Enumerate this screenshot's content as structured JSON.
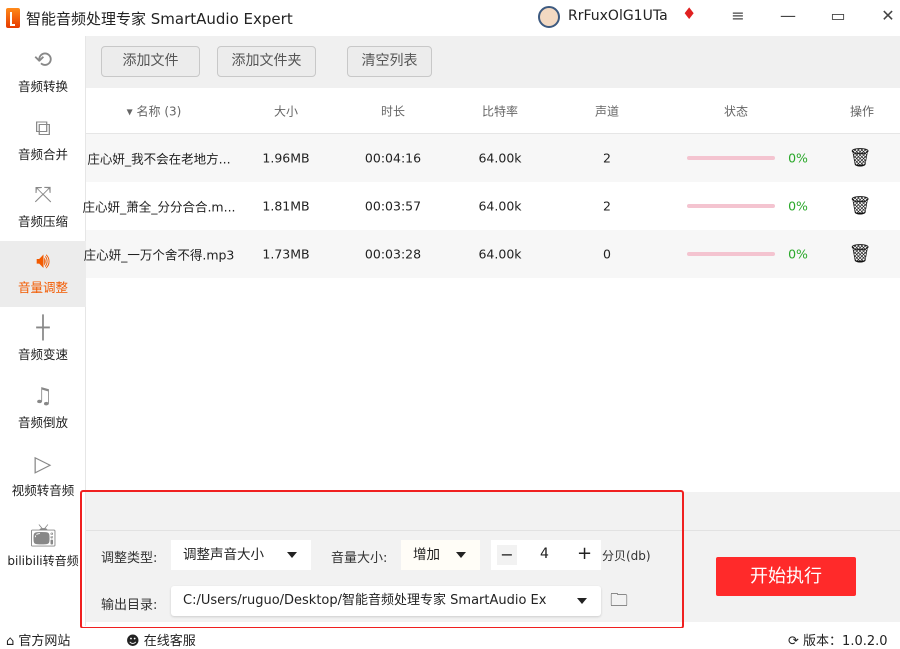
{
  "window": {
    "title": "智能音频处理专家 SmartAudio Expert",
    "username": "RrFuxOlG1UTa"
  },
  "sidebar": {
    "items": [
      {
        "label": "音频转换",
        "icon": "convert-icon"
      },
      {
        "label": "音频合并",
        "icon": "merge-icon"
      },
      {
        "label": "音频压缩",
        "icon": "compress-icon"
      },
      {
        "label": "音量调整",
        "icon": "volume-icon",
        "active": true
      },
      {
        "label": "音频变速",
        "icon": "speed-icon"
      },
      {
        "label": "音频倒放",
        "icon": "music-note-icon"
      },
      {
        "label": "视频转音频",
        "icon": "play-icon"
      },
      {
        "label": "bilibili转音频",
        "icon": "bilibili-icon"
      }
    ]
  },
  "toolbar": {
    "add_file": "添加文件",
    "add_folder": "添加文件夹",
    "clear_list": "清空列表"
  },
  "table": {
    "headers": {
      "name": "名称 (3)",
      "size": "大小",
      "duration": "时长",
      "bitrate": "比特率",
      "channels": "声道",
      "status": "状态",
      "action": "操作"
    },
    "rows": [
      {
        "name": "庄心妍_我不会在老地方...",
        "size": "1.96MB",
        "duration": "00:04:16",
        "bitrate": "64.00k",
        "channels": "2",
        "progress": "0%"
      },
      {
        "name": "庄心妍_萧全_分分合合.m...",
        "size": "1.81MB",
        "duration": "00:03:57",
        "bitrate": "64.00k",
        "channels": "2",
        "progress": "0%"
      },
      {
        "name": "庄心妍_一万个舍不得.mp3",
        "size": "1.73MB",
        "duration": "00:03:28",
        "bitrate": "64.00k",
        "channels": "0",
        "progress": "0%"
      }
    ]
  },
  "settings": {
    "type_label": "调整类型:",
    "type_value": "调整声音大小",
    "volume_label": "音量大小:",
    "volume_mode": "增加",
    "volume_value": "4",
    "unit": "分贝(db)",
    "output_label": "输出目录:",
    "output_path": "C:/Users/ruguo/Desktop/智能音频处理专家 SmartAudio Ex"
  },
  "start_button": "开始执行",
  "footer": {
    "website": "官方网站",
    "support": "在线客服",
    "version": "版本：1.0.2.0"
  },
  "colors": {
    "accent": "#f25a00",
    "start": "#ff2a2a",
    "progress": "#2aa82a"
  }
}
